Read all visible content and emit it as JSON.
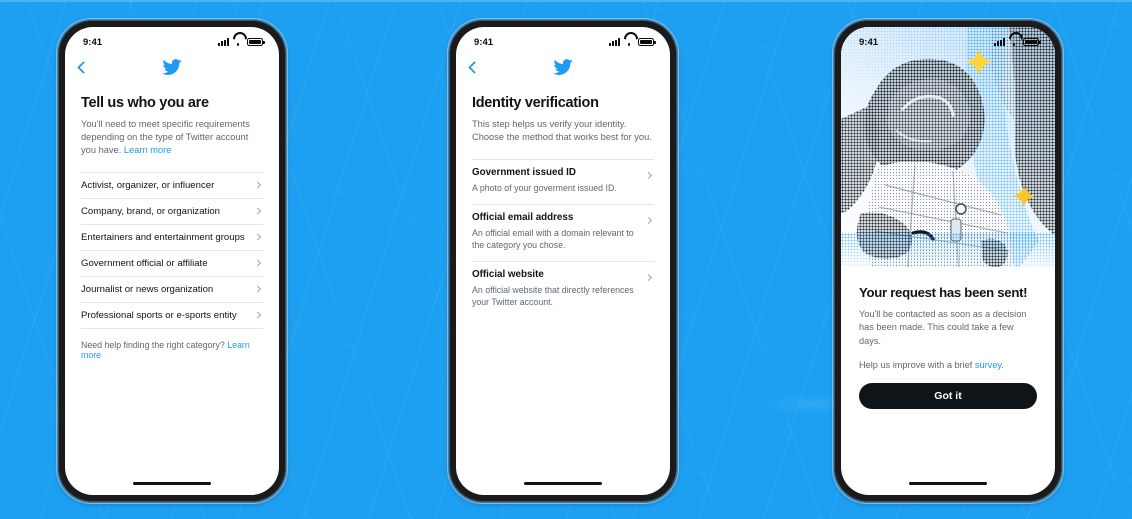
{
  "theme": {
    "background_blue": "#1DA0F2",
    "twitter_blue": "#1D9BF0",
    "text_primary": "#0F1419",
    "text_secondary": "#5D6772",
    "divider": "#E4E7EA",
    "button_dark": "#0F1419"
  },
  "status_bar": {
    "time": "9:41",
    "signal_icon": "cellular-signal-icon",
    "wifi_icon": "wifi-icon",
    "battery_icon": "battery-icon"
  },
  "screens": [
    {
      "id": "tell-us-who-you-are",
      "nav": {
        "back_icon": "back-chevron-icon",
        "logo_icon": "twitter-bird-icon"
      },
      "title": "Tell us who you are",
      "subtitle": "You'll need to meet specific requirements depending on the type of Twitter account you have. ",
      "subtitle_link": "Learn more",
      "options": [
        {
          "label": "Activist, organizer, or influencer"
        },
        {
          "label": "Company, brand, or organization"
        },
        {
          "label": "Entertainers and entertainment groups"
        },
        {
          "label": "Government official or affiliate"
        },
        {
          "label": "Journalist or news organization"
        },
        {
          "label": "Professional sports or e-sports entity"
        }
      ],
      "helper_text": "Need help finding the right category? ",
      "helper_link": "Learn more"
    },
    {
      "id": "identity-verification",
      "nav": {
        "back_icon": "back-chevron-icon",
        "logo_icon": "twitter-bird-icon"
      },
      "title": "Identity verification",
      "subtitle": "This step helps us verify your identity. Choose the method that works best for you.",
      "methods": [
        {
          "title": "Government issued ID",
          "description": "A photo of your goverment issued ID."
        },
        {
          "title": "Official email address",
          "description": "An official email with a domain relevant to the category you chose."
        },
        {
          "title": "Official website",
          "description": "An official website that directly references your Twitter account."
        }
      ]
    },
    {
      "id": "request-sent",
      "hero_image_alt": "halftone-astronaut-illustration",
      "title": "Your request has been sent!",
      "body": "You'll be contacted as soon as a decision has been made. This could take a few days.",
      "survey_prefix": "Help us improve with a brief ",
      "survey_link": "survey",
      "survey_suffix": ".",
      "button_label": "Got it"
    }
  ]
}
